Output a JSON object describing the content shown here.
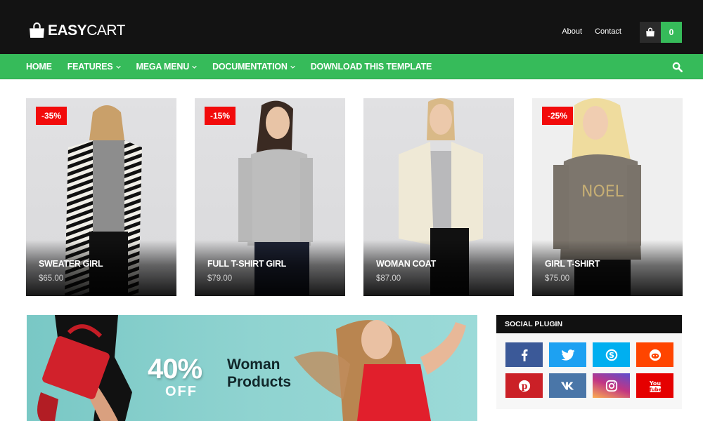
{
  "header": {
    "logo_bold": "EASY",
    "logo_light": "CART",
    "links": [
      "About",
      "Contact"
    ],
    "cart_count": "0"
  },
  "nav": {
    "items": [
      {
        "label": "HOME",
        "dropdown": false
      },
      {
        "label": "FEATURES",
        "dropdown": true
      },
      {
        "label": "MEGA MENU",
        "dropdown": true
      },
      {
        "label": "DOCUMENTATION",
        "dropdown": true
      },
      {
        "label": "DOWNLOAD THIS TEMPLATE",
        "dropdown": false
      }
    ],
    "search_icon": "search-icon"
  },
  "products": [
    {
      "title": "SWEATER GIRL",
      "price": "$65.00",
      "badge": "-35%"
    },
    {
      "title": "FULL T-SHIRT GIRL",
      "price": "$79.00",
      "badge": "-15%"
    },
    {
      "title": "WOMAN COAT",
      "price": "$87.00",
      "badge": null
    },
    {
      "title": "GIRL T-SHIRT",
      "price": "$75.00",
      "badge": "-25%"
    }
  ],
  "banner": {
    "discount": "40%",
    "off": "OFF",
    "line1": "Woman",
    "line2": "Products"
  },
  "social_widget": {
    "title": "SOCIAL PLUGIN",
    "icons": [
      {
        "name": "facebook",
        "color": "#3b5998"
      },
      {
        "name": "twitter",
        "color": "#1da1f2"
      },
      {
        "name": "skype",
        "color": "#00aff0"
      },
      {
        "name": "reddit",
        "color": "#ff4500"
      },
      {
        "name": "pinterest",
        "color": "#cb2027"
      },
      {
        "name": "vk",
        "color": "#4a76a8"
      },
      {
        "name": "instagram",
        "color": "#c13584"
      },
      {
        "name": "youtube",
        "color": "#e50000"
      }
    ]
  },
  "colors": {
    "accent": "#36bb5a",
    "topbar": "#131313",
    "badge": "#f20b0b"
  }
}
